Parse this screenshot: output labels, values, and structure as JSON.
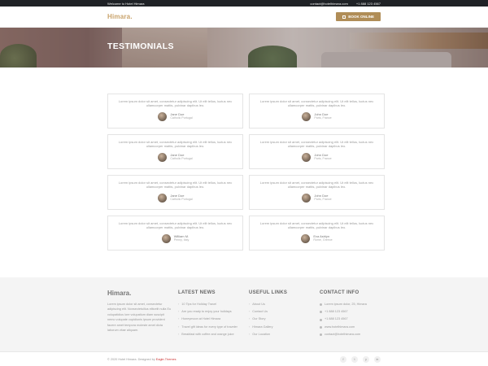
{
  "topbar": {
    "welcome": "Welcome to Hotel Himara",
    "email": "contact@hotelhimara.com",
    "phone": "+1 888 123 4567"
  },
  "header": {
    "logo": "Himara.",
    "book_label": "BOOK ONLINE"
  },
  "hero": {
    "title": "TESTIMONIALS"
  },
  "testimonials": [
    {
      "quote": "Lorem ipsum dolor sit amet, consectetur adipiscing elit. Ut elit tellus, luctus nec ullamcorper mattis, pulvinar dapibus leo.",
      "name": "Jane Doe",
      "role": "Catholic Portugal"
    },
    {
      "quote": "Lorem ipsum dolor sit amet, consectetur adipiscing elit. Ut elit tellus, luctus nec ullamcorper mattis, pulvinar dapibus leo.",
      "name": "John Doe",
      "role": "Paris, France"
    },
    {
      "quote": "Lorem ipsum dolor sit amet, consectetur adipiscing elit. Ut elit tellus, luctus nec ullamcorper mattis, pulvinar dapibus leo.",
      "name": "Jane Doe",
      "role": "Catholic Portugal"
    },
    {
      "quote": "Lorem ipsum dolor sit amet, consectetur adipiscing elit. Ut elit tellus, luctus nec ullamcorper mattis, pulvinar dapibus leo.",
      "name": "John Doe",
      "role": "Paris, France"
    },
    {
      "quote": "Lorem ipsum dolor sit amet, consectetur adipiscing elit. Ut elit tellus, luctus nec ullamcorper mattis, pulvinar dapibus leo.",
      "name": "Jane Doe",
      "role": "Catholic Portugal"
    },
    {
      "quote": "Lorem ipsum dolor sit amet, consectetur adipiscing elit. Ut elit tellus, luctus nec ullamcorper mattis, pulvinar dapibus leo.",
      "name": "John Doe",
      "role": "Paris, France"
    },
    {
      "quote": "Lorem ipsum dolor sit amet, consectetur adipiscing elit. Ut elit tellus, luctus nec ullamcorper mattis, pulvinar dapibus leo.",
      "name": "William M.",
      "role": "Penny, Italy"
    },
    {
      "quote": "Lorem ipsum dolor sit amet, consectetur adipiscing elit. Ut elit tellus, luctus nec ullamcorper mattis, pulvinar dapibus leo.",
      "name": "Eva Ashlyn",
      "role": "Rome, Greece"
    }
  ],
  "footer": {
    "brand": {
      "logo": "Himara.",
      "text": "Lorem ipsum dolor sit amet, consectetur adipiscing elit. Nonsectetuilius elitcelit nulla Eu volupatidius lore volupatium diam suscipit nemo volupate cupidiunis ipsum provident facere amet tempora moleste amet dicta laborum vitae aliquam."
    },
    "news": {
      "title": "LATEST NEWS",
      "items": [
        "10 Tips for Holiday Travel",
        "Are you ready to enjoy your holidays",
        "Honeymoon at Hotel Himara",
        "Travel gift ideas for every type of traveler",
        "Breakfast with coffee and orange juice"
      ]
    },
    "links": {
      "title": "USEFUL LINKS",
      "items": [
        "About Us",
        "Contact Us",
        "Our Story",
        "Himara Gallery",
        "Our Location"
      ]
    },
    "contact": {
      "title": "CONTACT INFO",
      "address": "Lorem ipsum dolor, 25, Himara",
      "phone1": "+1 888 123 4567",
      "phone2": "+1 888 123 4567",
      "website": "www.hotelhimara.com",
      "email": "contact@hotelhimara.com"
    }
  },
  "bottombar": {
    "copyright_prefix": "© 2020 Hotel Himara. Designed by",
    "designer": "Eagle-Themes",
    "social": [
      "f",
      "t",
      "y",
      "in"
    ]
  },
  "colors": {
    "accent": "#b08d57",
    "logo": "#c9a36b",
    "dark": "#1f2226"
  }
}
